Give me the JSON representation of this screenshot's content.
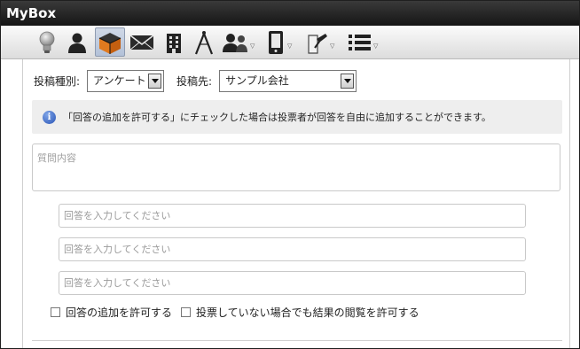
{
  "window": {
    "title": "MyBox"
  },
  "toolbar": {
    "icons": [
      "lightbulb-icon",
      "person-icon",
      "box-icon",
      "mail-icon",
      "building-icon",
      "compass-icon",
      "group-icon",
      "phone-icon",
      "pin-icon",
      "list-icon"
    ],
    "active": "box-icon"
  },
  "form": {
    "post_type_label": "投稿種別:",
    "post_type_value": "アンケート",
    "post_target_label": "投稿先:",
    "post_target_value": "サンプル会社",
    "info_icon": "i",
    "info_text": "「回答の追加を許可する」にチェックした場合は投票者が回答を自由に追加することができます。",
    "question_placeholder": "質問内容",
    "answer_placeholders": [
      "回答を入力してください",
      "回答を入力してください",
      "回答を入力してください"
    ],
    "checkbox_allow_add": "回答の追加を許可する",
    "checkbox_allow_view": "投票していない場合でも結果の閲覧を許可する"
  }
}
